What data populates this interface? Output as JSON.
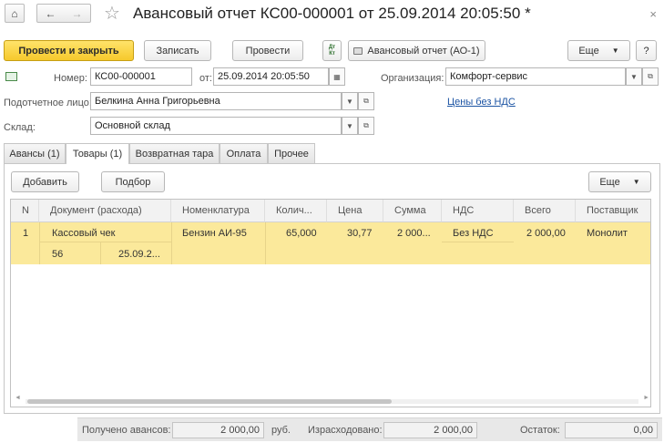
{
  "header": {
    "title": "Авансовый отчет КС00-000001 от 25.09.2014 20:05:50 *",
    "home_glyph": "⌂",
    "back_glyph": "←",
    "forward_glyph": "→",
    "star_glyph": "☆",
    "close_glyph": "×"
  },
  "toolbar": {
    "post_close_label": "Провести и закрыть",
    "save_label": "Записать",
    "post_label": "Провести",
    "dtkt_label": "Дт Кт",
    "print_label": "Авансовый отчет (АО-1)",
    "more_label": "Еще",
    "help_label": "?"
  },
  "form": {
    "number_label": "Номер:",
    "number_value": "КС00-000001",
    "date_label": "от:",
    "date_value": "25.09.2014 20:05:50",
    "org_label": "Организация:",
    "org_value": "Комфорт-сервис",
    "person_label": "Подотчетное лицо:",
    "person_value": "Белкина Анна  Григорьевна",
    "prices_link": "Цены без НДС",
    "warehouse_label": "Склад:",
    "warehouse_value": "Основной склад"
  },
  "tabs": [
    {
      "label": "Авансы (1)"
    },
    {
      "label": "Товары (1)"
    },
    {
      "label": "Возвратная тара"
    },
    {
      "label": "Оплата"
    },
    {
      "label": "Прочее"
    }
  ],
  "table_toolbar": {
    "add_label": "Добавить",
    "select_label": "Подбор",
    "more_label": "Еще"
  },
  "table": {
    "columns": [
      "N",
      "Документ (расхода)",
      "Номенклатура",
      "Колич...",
      "Цена",
      "Сумма",
      "НДС",
      "Всего",
      "Поставщик"
    ],
    "rows": [
      {
        "n": "1",
        "document": "Кассовый чек",
        "doc_number": "56",
        "doc_date": "25.09.2...",
        "item": "Бензин АИ-95",
        "qty": "65,000",
        "price": "30,77",
        "sum": "2 000...",
        "vat": "Без НДС",
        "total": "2 000,00",
        "supplier": "Монолит"
      }
    ]
  },
  "footer": {
    "received_label": "Получено авансов:",
    "received_value": "2 000,00",
    "currency": "руб.",
    "spent_label": "Израсходовано:",
    "spent_value": "2 000,00",
    "balance_label": "Остаток:",
    "balance_value": "0,00"
  }
}
